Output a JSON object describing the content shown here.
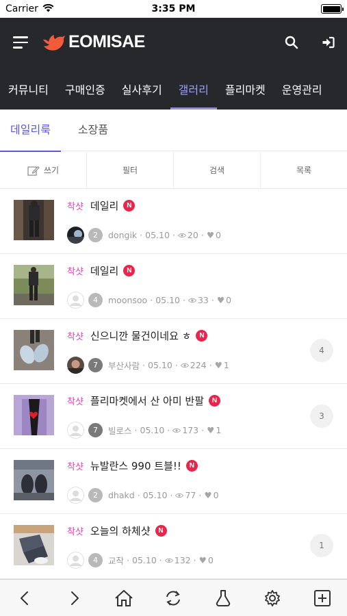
{
  "status": {
    "carrier": "Carrier",
    "time": "3:35 PM"
  },
  "brand": {
    "name": "EOMISAE",
    "accent": "#f25a3c",
    "active_color": "#8f8bf2"
  },
  "nav": {
    "items": [
      "커뮤니티",
      "구매인증",
      "실사후기",
      "갤러리",
      "플리마켓",
      "운영관리"
    ],
    "active": "갤러리"
  },
  "subtabs": {
    "items": [
      "데일리룩",
      "소장품"
    ],
    "active": "데일리룩"
  },
  "toolbar": {
    "write": "쓰기",
    "filter": "필터",
    "search": "검색",
    "list": "목록"
  },
  "posts": [
    {
      "category": "착샷",
      "title": "데일리",
      "new_badge": "N",
      "level": "2",
      "author": "dongik",
      "date": "05.10",
      "views": "20",
      "likes": "0",
      "comments": ""
    },
    {
      "category": "착샷",
      "title": "데일리",
      "new_badge": "N",
      "level": "4",
      "author": "moonsoo",
      "date": "05.10",
      "views": "33",
      "likes": "0",
      "comments": ""
    },
    {
      "category": "착샷",
      "title": "신으니깐 물건이네요 ㅎ",
      "new_badge": "N",
      "level": "7",
      "author": "부산사람",
      "date": "05.10",
      "views": "224",
      "likes": "1",
      "comments": "4"
    },
    {
      "category": "착샷",
      "title": "플리마켓에서 산 아미 반팔",
      "new_badge": "N",
      "level": "7",
      "author": "빌로스",
      "date": "05.10",
      "views": "173",
      "likes": "1",
      "comments": "3"
    },
    {
      "category": "착샷",
      "title": "뉴발란스 990 트블!!",
      "new_badge": "N",
      "level": "2",
      "author": "dhakd",
      "date": "05.10",
      "views": "77",
      "likes": "0",
      "comments": ""
    },
    {
      "category": "착샷",
      "title": "오늘의 하체샷",
      "new_badge": "N",
      "level": "4",
      "author": "교작",
      "date": "05.10",
      "views": "132",
      "likes": "0",
      "comments": "1"
    }
  ],
  "meta": {
    "separator": "·",
    "heart": "♥"
  },
  "bottom_icons": [
    "back-icon",
    "forward-icon",
    "home-icon",
    "refresh-icon",
    "profile-icon",
    "settings-icon",
    "new-post-icon"
  ]
}
